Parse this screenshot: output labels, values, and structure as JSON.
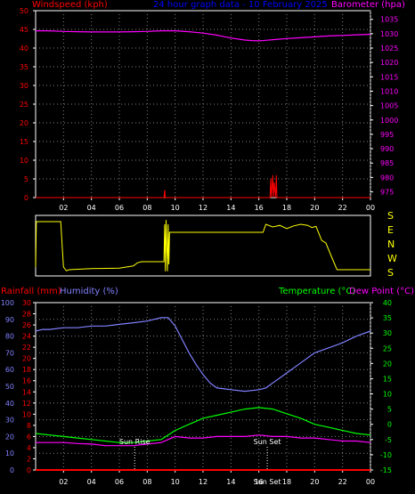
{
  "colors": {
    "windspeed": "#ff0000",
    "barometer": "#ff00ff",
    "title": "#0000ff",
    "rainfall": "#ff0000",
    "humidity": "#8080ff",
    "temperature": "#00ff00",
    "dewpoint": "#ff00ff",
    "wind_direction": "#ffff00",
    "axes": "#ffffff",
    "grid": "#808080",
    "sun_marker": "#ffffff"
  },
  "wind_dir_letters": [
    "S",
    "E",
    "N",
    "W",
    "S"
  ],
  "chart_data": [
    {
      "type": "line",
      "title": "24 hour graph data - 10 February 2025",
      "ylabel_left": "Windspeed (kph)",
      "ylabel_right": "Barometer (hpa)",
      "x_ticks": [
        "02",
        "04",
        "06",
        "08",
        "10",
        "12",
        "14",
        "16",
        "18",
        "20",
        "22",
        "00"
      ],
      "xlim": [
        0,
        24
      ],
      "y_left_ticks": [
        "0",
        "5",
        "10",
        "15",
        "20",
        "25",
        "30",
        "35",
        "40",
        "45",
        "50"
      ],
      "ylim_left": [
        0,
        50
      ],
      "y_right_ticks": [
        "975",
        "980",
        "985",
        "990",
        "995",
        "1000",
        "1005",
        "1010",
        "1015",
        "1020",
        "1025",
        "1030",
        "1035"
      ],
      "ylim_right": [
        973,
        1038
      ],
      "grid": true,
      "series": [
        {
          "name": "Barometer (hpa)",
          "axis": "right",
          "x": [
            0,
            1,
            2,
            3,
            4,
            5,
            6,
            7,
            8,
            9,
            10,
            11,
            12,
            13,
            14,
            15,
            15.5,
            16,
            16.5,
            17,
            18,
            19,
            20,
            21,
            22,
            23,
            24
          ],
          "values": [
            1031,
            1031,
            1030.8,
            1030.7,
            1030.6,
            1030.6,
            1030.6,
            1030.7,
            1030.8,
            1031,
            1031,
            1030.7,
            1030.2,
            1029.5,
            1028.5,
            1027.8,
            1027.6,
            1027.5,
            1027.7,
            1027.9,
            1028.3,
            1028.6,
            1028.9,
            1029.2,
            1029.4,
            1029.6,
            1029.8
          ]
        },
        {
          "name": "Windspeed (kph)",
          "axis": "left",
          "x": [
            0,
            9.2,
            9.25,
            9.3,
            16.8,
            16.85,
            16.9,
            17.0,
            17.05,
            17.1,
            17.2,
            17.25,
            17.3,
            24
          ],
          "values": [
            0,
            0,
            2,
            0,
            0,
            5,
            0,
            6,
            0,
            4,
            0,
            6,
            0,
            0
          ]
        }
      ]
    },
    {
      "type": "line",
      "title": "",
      "xlim": [
        0,
        24
      ],
      "grid": false,
      "categories_right": [
        "S",
        "E",
        "N",
        "W",
        "S"
      ],
      "series": [
        {
          "name": "",
          "x": [
            0,
            0.05,
            1.8,
            1.9,
            2.0,
            2.2,
            2.4,
            4.0,
            6.0,
            7.0,
            7.3,
            7.6,
            8.0,
            9.2,
            9.25,
            9.3,
            9.35,
            9.45,
            9.5,
            9.55,
            9.6,
            9.7,
            16.3,
            16.5,
            17.0,
            17.5,
            18.0,
            18.5,
            19.0,
            19.5,
            19.8,
            20.1,
            20.5,
            20.8,
            21.2,
            21.6,
            24
          ],
          "values": [
            0.1,
            0.95,
            0.95,
            0.5,
            0.1,
            0.03,
            0.05,
            0.07,
            0.08,
            0.12,
            0.18,
            0.2,
            0.2,
            0.2,
            0.9,
            0.02,
            0.98,
            0.02,
            0.9,
            0.15,
            0.75,
            0.75,
            0.75,
            0.9,
            0.85,
            0.88,
            0.82,
            0.87,
            0.9,
            0.88,
            0.84,
            0.86,
            0.6,
            0.55,
            0.3,
            0.05,
            0.05
          ]
        }
      ]
    },
    {
      "type": "line",
      "title": "",
      "ylabel_left_1": "Rainfall (mm)",
      "ylabel_left_2": "Humidity (%)",
      "ylabel_right_1": "Temperature (°C)",
      "ylabel_right_2": "Dew Point (°C)",
      "x_ticks": [
        "02",
        "04",
        "06",
        "08",
        "10",
        "12",
        "14",
        "16",
        "18",
        "20",
        "22",
        "00"
      ],
      "xlim": [
        0,
        24
      ],
      "humidity_ticks": [
        "0",
        "10",
        "20",
        "30",
        "40",
        "50",
        "60",
        "70",
        "80",
        "90",
        "100"
      ],
      "ylim_humidity": [
        0,
        100
      ],
      "rainfall_ticks": [
        "0",
        "2",
        "4",
        "6",
        "8",
        "10",
        "12",
        "14",
        "16",
        "18",
        "20",
        "22",
        "24",
        "26",
        "28",
        "30"
      ],
      "ylim_rainfall": [
        0,
        30
      ],
      "temp_ticks": [
        "-15",
        "-10",
        "-5",
        "0",
        "5",
        "10",
        "15",
        "20",
        "25",
        "30",
        "35",
        "40"
      ],
      "ylim_temp": [
        -15,
        40
      ],
      "grid": true,
      "annotations": [
        {
          "text": "Sun Rise",
          "x": 7.1
        },
        {
          "text": "Sun Set",
          "x": 16.6
        }
      ],
      "x_marker_labels": [
        "Sun Set"
      ],
      "series": [
        {
          "name": "Humidity (%)",
          "scale": "humidity",
          "x": [
            0,
            0.5,
            1,
            2,
            3,
            4,
            5,
            6,
            7,
            8,
            9,
            9.5,
            10,
            10.5,
            11,
            11.5,
            12,
            12.5,
            13,
            14,
            15,
            16,
            16.5,
            17,
            17.5,
            18,
            19,
            20,
            21,
            22,
            23,
            24
          ],
          "values": [
            83,
            84,
            84,
            85,
            85,
            86,
            86,
            87,
            88,
            89,
            91,
            91,
            86,
            78,
            70,
            63,
            57,
            52,
            49,
            48,
            47,
            48,
            49,
            52,
            55,
            58,
            64,
            70,
            73,
            76,
            80,
            83
          ]
        },
        {
          "name": "Temperature (°C)",
          "scale": "temp",
          "x": [
            0,
            1,
            2,
            3,
            4,
            5,
            6,
            7,
            8,
            9,
            10,
            11,
            12,
            13,
            14,
            15,
            16,
            17,
            18,
            19,
            20,
            21,
            22,
            23,
            24
          ],
          "values": [
            -3,
            -3.5,
            -4,
            -4.5,
            -5,
            -5.5,
            -6,
            -6,
            -5.5,
            -5,
            -2,
            0,
            2,
            3,
            4,
            5,
            5.5,
            5,
            3.5,
            2,
            0,
            -1,
            -2,
            -3,
            -3.5
          ]
        },
        {
          "name": "Dew Point (°C)",
          "scale": "temp",
          "x": [
            0,
            1,
            2,
            3,
            4,
            5,
            6,
            7,
            8,
            9,
            10,
            11,
            12,
            13,
            14,
            15,
            16,
            17,
            18,
            19,
            20,
            21,
            22,
            23,
            24
          ],
          "values": [
            -6,
            -6,
            -6,
            -6.3,
            -6.5,
            -7,
            -7,
            -7,
            -6.5,
            -6,
            -4,
            -4.5,
            -4.5,
            -4,
            -4,
            -4,
            -3.5,
            -4,
            -4,
            -4.5,
            -4.5,
            -5,
            -5.5,
            -5.5,
            -6
          ]
        },
        {
          "name": "Rainfall (mm)",
          "scale": "rainfall",
          "x": [
            0,
            24
          ],
          "values": [
            0,
            0
          ]
        }
      ]
    }
  ]
}
